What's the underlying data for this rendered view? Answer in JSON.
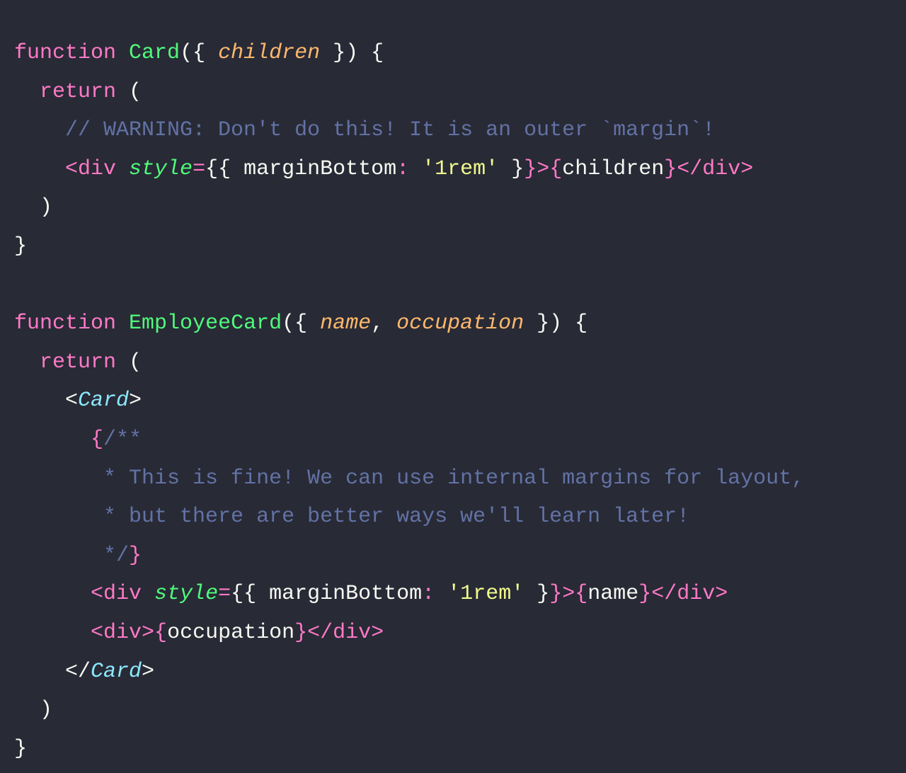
{
  "editor": {
    "language": "jsx",
    "theme_name": "dracula",
    "background_color": "#282a36",
    "foreground_color": "#f8f8f2",
    "font_size_px": 30,
    "line_height_px": 54.6,
    "colors": {
      "keyword": "#ff79c6",
      "function": "#50fa7b",
      "parameter": "#ffb86c",
      "attribute": "#50fa7b",
      "string": "#f1fa8c",
      "comment": "#6272a4",
      "component": "#8be9fd",
      "punctuation": "#f8f8f2"
    }
  },
  "code": {
    "plain_text": "function Card({ children }) {\n  return (\n    // WARNING: Don't do this! It is an outer `margin`!\n    <div style={{ marginBottom: '1rem' }}>{children}</div>\n  )\n}\n\nfunction EmployeeCard({ name, occupation }) {\n  return (\n    <Card>\n      {/**\n       * This is fine! We can use internal margins for layout,\n       * but there are better ways we'll learn later!\n       */}\n      <div style={{ marginBottom: '1rem' }}>{name}</div>\n      <div>{occupation}</div>\n    </Card>\n  )\n}",
    "lines": [
      {
        "number": 1,
        "text": "function Card({ children }) {",
        "tokens": [
          {
            "t": "function",
            "c": "keyword"
          },
          {
            "t": " ",
            "c": "plain"
          },
          {
            "t": "Card",
            "c": "function"
          },
          {
            "t": "({ ",
            "c": "punctuation"
          },
          {
            "t": "children",
            "c": "parameter"
          },
          {
            "t": " }) {",
            "c": "punctuation"
          }
        ]
      },
      {
        "number": 2,
        "text": "  return (",
        "tokens": [
          {
            "t": "  ",
            "c": "plain"
          },
          {
            "t": "return",
            "c": "keyword"
          },
          {
            "t": " (",
            "c": "punctuation"
          }
        ]
      },
      {
        "number": 3,
        "text": "    // WARNING: Don't do this! It is an outer `margin`!",
        "tokens": [
          {
            "t": "    ",
            "c": "plain"
          },
          {
            "t": "// WARNING: Don't do this! It is an outer `margin`!",
            "c": "comment"
          }
        ]
      },
      {
        "number": 4,
        "text": "    <div style={{ marginBottom: '1rem' }}>{children}</div>",
        "tokens": [
          {
            "t": "    ",
            "c": "plain"
          },
          {
            "t": "<div",
            "c": "keyword"
          },
          {
            "t": " ",
            "c": "plain"
          },
          {
            "t": "style",
            "c": "attribute"
          },
          {
            "t": "=",
            "c": "keyword"
          },
          {
            "t": "{{ ",
            "c": "punctuation"
          },
          {
            "t": "marginBottom",
            "c": "punctuation"
          },
          {
            "t": ":",
            "c": "keyword"
          },
          {
            "t": " ",
            "c": "plain"
          },
          {
            "t": "'1rem'",
            "c": "string"
          },
          {
            "t": " }",
            "c": "punctuation"
          },
          {
            "t": "}>",
            "c": "keyword"
          },
          {
            "t": "{",
            "c": "keyword"
          },
          {
            "t": "children",
            "c": "punctuation"
          },
          {
            "t": "}",
            "c": "keyword"
          },
          {
            "t": "</div>",
            "c": "keyword"
          }
        ]
      },
      {
        "number": 5,
        "text": "  )",
        "tokens": [
          {
            "t": "  )",
            "c": "punctuation"
          }
        ]
      },
      {
        "number": 6,
        "text": "}",
        "tokens": [
          {
            "t": "}",
            "c": "punctuation"
          }
        ]
      },
      {
        "number": 7,
        "text": "",
        "tokens": []
      },
      {
        "number": 8,
        "text": "function EmployeeCard({ name, occupation }) {",
        "tokens": [
          {
            "t": "function",
            "c": "keyword"
          },
          {
            "t": " ",
            "c": "plain"
          },
          {
            "t": "EmployeeCard",
            "c": "function"
          },
          {
            "t": "({ ",
            "c": "punctuation"
          },
          {
            "t": "name",
            "c": "parameter"
          },
          {
            "t": ", ",
            "c": "punctuation"
          },
          {
            "t": "occupation",
            "c": "parameter"
          },
          {
            "t": " }) {",
            "c": "punctuation"
          }
        ]
      },
      {
        "number": 9,
        "text": "  return (",
        "tokens": [
          {
            "t": "  ",
            "c": "plain"
          },
          {
            "t": "return",
            "c": "keyword"
          },
          {
            "t": " (",
            "c": "punctuation"
          }
        ]
      },
      {
        "number": 10,
        "text": "    <Card>",
        "tokens": [
          {
            "t": "    <",
            "c": "punctuation"
          },
          {
            "t": "Card",
            "c": "component"
          },
          {
            "t": ">",
            "c": "punctuation"
          }
        ]
      },
      {
        "number": 11,
        "text": "      {/**",
        "tokens": [
          {
            "t": "      ",
            "c": "plain"
          },
          {
            "t": "{",
            "c": "keyword"
          },
          {
            "t": "/**",
            "c": "comment"
          }
        ]
      },
      {
        "number": 12,
        "text": "       * This is fine! We can use internal margins for layout,",
        "tokens": [
          {
            "t": "       ",
            "c": "plain"
          },
          {
            "t": "* This is fine! We can use internal margins for layout,",
            "c": "comment"
          }
        ]
      },
      {
        "number": 13,
        "text": "       * but there are better ways we'll learn later!",
        "tokens": [
          {
            "t": "       ",
            "c": "plain"
          },
          {
            "t": "* but there are better ways we'll learn later!",
            "c": "comment"
          }
        ]
      },
      {
        "number": 14,
        "text": "       */}",
        "tokens": [
          {
            "t": "       ",
            "c": "plain"
          },
          {
            "t": "*/",
            "c": "comment"
          },
          {
            "t": "}",
            "c": "keyword"
          }
        ]
      },
      {
        "number": 15,
        "text": "      <div style={{ marginBottom: '1rem' }}>{name}</div>",
        "tokens": [
          {
            "t": "      ",
            "c": "plain"
          },
          {
            "t": "<div",
            "c": "keyword"
          },
          {
            "t": " ",
            "c": "plain"
          },
          {
            "t": "style",
            "c": "attribute"
          },
          {
            "t": "=",
            "c": "keyword"
          },
          {
            "t": "{{ ",
            "c": "punctuation"
          },
          {
            "t": "marginBottom",
            "c": "punctuation"
          },
          {
            "t": ":",
            "c": "keyword"
          },
          {
            "t": " ",
            "c": "plain"
          },
          {
            "t": "'1rem'",
            "c": "string"
          },
          {
            "t": " }",
            "c": "punctuation"
          },
          {
            "t": "}>",
            "c": "keyword"
          },
          {
            "t": "{",
            "c": "keyword"
          },
          {
            "t": "name",
            "c": "punctuation"
          },
          {
            "t": "}",
            "c": "keyword"
          },
          {
            "t": "</div>",
            "c": "keyword"
          }
        ]
      },
      {
        "number": 16,
        "text": "      <div>{occupation}</div>",
        "tokens": [
          {
            "t": "      ",
            "c": "plain"
          },
          {
            "t": "<div>",
            "c": "keyword"
          },
          {
            "t": "{",
            "c": "keyword"
          },
          {
            "t": "occupation",
            "c": "punctuation"
          },
          {
            "t": "}",
            "c": "keyword"
          },
          {
            "t": "</div>",
            "c": "keyword"
          }
        ]
      },
      {
        "number": 17,
        "text": "    </Card>",
        "tokens": [
          {
            "t": "    </",
            "c": "punctuation"
          },
          {
            "t": "Card",
            "c": "component"
          },
          {
            "t": ">",
            "c": "punctuation"
          }
        ]
      },
      {
        "number": 18,
        "text": "  )",
        "tokens": [
          {
            "t": "  )",
            "c": "punctuation"
          }
        ]
      },
      {
        "number": 19,
        "text": "}",
        "tokens": [
          {
            "t": "}",
            "c": "punctuation"
          }
        ]
      }
    ]
  }
}
